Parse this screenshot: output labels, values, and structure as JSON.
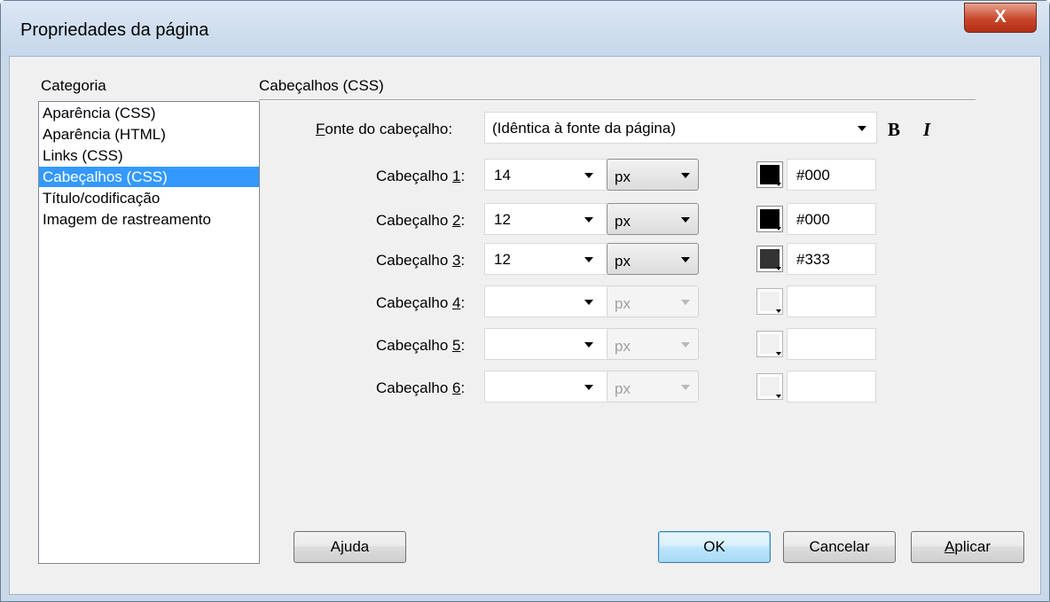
{
  "window": {
    "title": "Propriedades da página",
    "close_glyph": "X"
  },
  "category": {
    "label": "Categoria",
    "items": [
      "Aparência (CSS)",
      "Aparência (HTML)",
      "Links (CSS)",
      "Cabeçalhos (CSS)",
      "Título/codificação",
      "Imagem de rastreamento"
    ],
    "selected_index": 3
  },
  "section": {
    "title": "Cabeçalhos (CSS)",
    "font_label_prefix": "F",
    "font_label_rest": "onte do cabeçalho:",
    "font_value": "(Idêntica à fonte da página)",
    "bold_label": "B",
    "italic_label": "I"
  },
  "headings": [
    {
      "label": "Cabeçalho ",
      "num": "1",
      "colon": ":",
      "size": "14",
      "unit": "px",
      "unit_enabled": true,
      "color": "#000",
      "color_hex": "#000"
    },
    {
      "label": "Cabeçalho ",
      "num": "2",
      "colon": ":",
      "size": "12",
      "unit": "px",
      "unit_enabled": true,
      "color": "#000",
      "color_hex": "#000"
    },
    {
      "label": "Cabeçalho ",
      "num": "3",
      "colon": ":",
      "size": "12",
      "unit": "px",
      "unit_enabled": true,
      "color": "#333",
      "color_hex": "#333333"
    },
    {
      "label": "Cabeçalho ",
      "num": "4",
      "colon": ":",
      "size": "",
      "unit": "px",
      "unit_enabled": false,
      "color": "",
      "color_hex": ""
    },
    {
      "label": "Cabeçalho ",
      "num": "5",
      "colon": ":",
      "size": "",
      "unit": "px",
      "unit_enabled": false,
      "color": "",
      "color_hex": ""
    },
    {
      "label": "Cabeçalho ",
      "num": "6",
      "colon": ":",
      "size": "",
      "unit": "px",
      "unit_enabled": false,
      "color": "",
      "color_hex": ""
    }
  ],
  "buttons": {
    "help_prefix": "A",
    "help_u": "j",
    "help_rest": "uda",
    "ok": "OK",
    "cancel": "Cancelar",
    "apply_u": "A",
    "apply_rest": "plicar"
  },
  "colors": {
    "selection": "#3399ff",
    "default_button_border": "#3c7fb1",
    "close_button": "#c7462b"
  }
}
